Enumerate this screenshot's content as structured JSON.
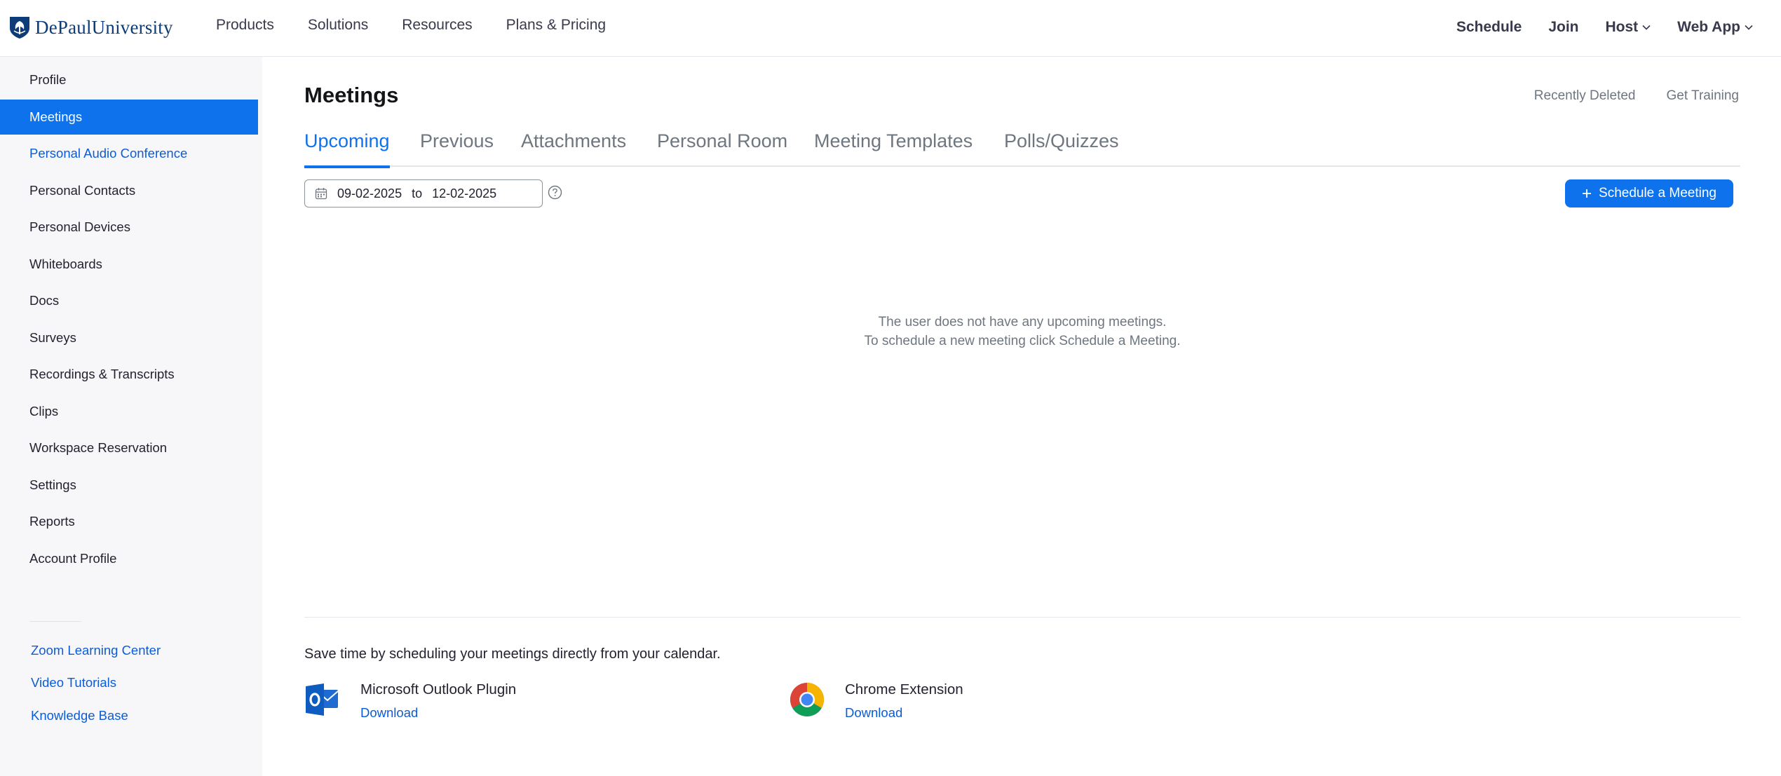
{
  "brand": {
    "logo_text": "DePaulUniversity",
    "logo_icon": "depaul-shield-logo"
  },
  "topnav": {
    "left": [
      "Products",
      "Solutions",
      "Resources",
      "Plans & Pricing"
    ],
    "right": {
      "schedule": "Schedule",
      "join": "Join",
      "host": "Host",
      "web_app": "Web App"
    }
  },
  "sidebar": {
    "items": [
      {
        "label": "Profile"
      },
      {
        "label": "Meetings",
        "active": true
      },
      {
        "label": "Personal Audio Conference",
        "link": true
      },
      {
        "label": "Personal Contacts"
      },
      {
        "label": "Personal Devices"
      },
      {
        "label": "Whiteboards"
      },
      {
        "label": "Docs"
      },
      {
        "label": "Surveys"
      },
      {
        "label": "Recordings & Transcripts"
      },
      {
        "label": "Clips"
      },
      {
        "label": "Workspace Reservation"
      },
      {
        "label": "Settings"
      },
      {
        "label": "Reports"
      },
      {
        "label": "Account Profile"
      }
    ],
    "help_links": [
      "Zoom Learning Center",
      "Video Tutorials",
      "Knowledge Base"
    ]
  },
  "main": {
    "title": "Meetings",
    "top_links": {
      "recently_deleted": "Recently Deleted",
      "get_training": "Get Training"
    },
    "tabs": [
      {
        "label": "Upcoming",
        "active": true
      },
      {
        "label": "Previous"
      },
      {
        "label": "Attachments"
      },
      {
        "label": "Personal Room"
      },
      {
        "label": "Meeting Templates"
      },
      {
        "label": "Polls/Quizzes"
      }
    ],
    "date_range": {
      "from": "09-02-2025",
      "separator": "to",
      "to": "12-02-2025"
    },
    "schedule_button": "Schedule a Meeting",
    "empty_state": {
      "line1": "The user does not have any upcoming meetings.",
      "line2": "To schedule a new meeting click Schedule a Meeting."
    },
    "calendar_tip": "Save time by scheduling your meetings directly from your calendar.",
    "plugins": [
      {
        "name": "Microsoft Outlook Plugin",
        "action": "Download",
        "icon": "outlook-icon"
      },
      {
        "name": "Chrome Extension",
        "action": "Download",
        "icon": "chrome-icon"
      }
    ]
  },
  "colors": {
    "accent": "#0e72ed",
    "link": "#0b5cd5",
    "sidebar_bg": "#f7f7fa",
    "brand_navy": "#0d3c78"
  }
}
